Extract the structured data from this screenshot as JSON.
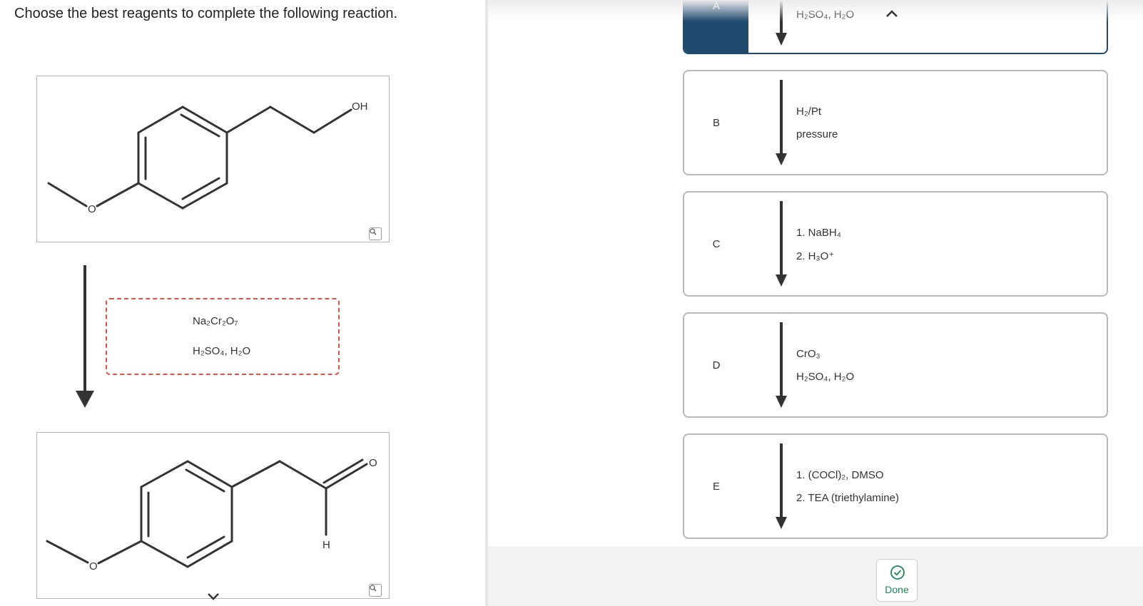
{
  "question": "Choose the best reagents to complete the following reaction.",
  "starting_material": {
    "labels": [
      "OH",
      "O"
    ]
  },
  "product": {
    "labels": [
      "O",
      "H",
      "O"
    ]
  },
  "drop_zone": {
    "line1": "Na₂Cr₂O₇",
    "line2": "H₂SO₄, H₂O"
  },
  "options": [
    {
      "letter": "A",
      "line1": "H₂SO₄, H₂O",
      "line2": "",
      "selected": true
    },
    {
      "letter": "B",
      "line1": "H₂/Pt",
      "line2": "pressure",
      "selected": false
    },
    {
      "letter": "C",
      "line1": "1. NaBH₄",
      "line2": "2. H₃O⁺",
      "selected": false
    },
    {
      "letter": "D",
      "line1": "CrO₃",
      "line2": "H₂SO₄, H₂O",
      "selected": false
    },
    {
      "letter": "E",
      "line1": "1. (COCl)₂, DMSO",
      "line2": "2. TEA (triethylamine)",
      "selected": false
    }
  ],
  "done_button": {
    "label": "Done"
  },
  "icons": {
    "zoom": "magnifier-icon",
    "collapse": "chevron-up-icon",
    "expand": "chevron-down-icon",
    "done": "check-circle-icon"
  },
  "colors": {
    "selected_accent": "#1f4a6e",
    "drop_zone_border": "#d9534f",
    "done_green": "#1a8754",
    "bond": "#333333"
  }
}
